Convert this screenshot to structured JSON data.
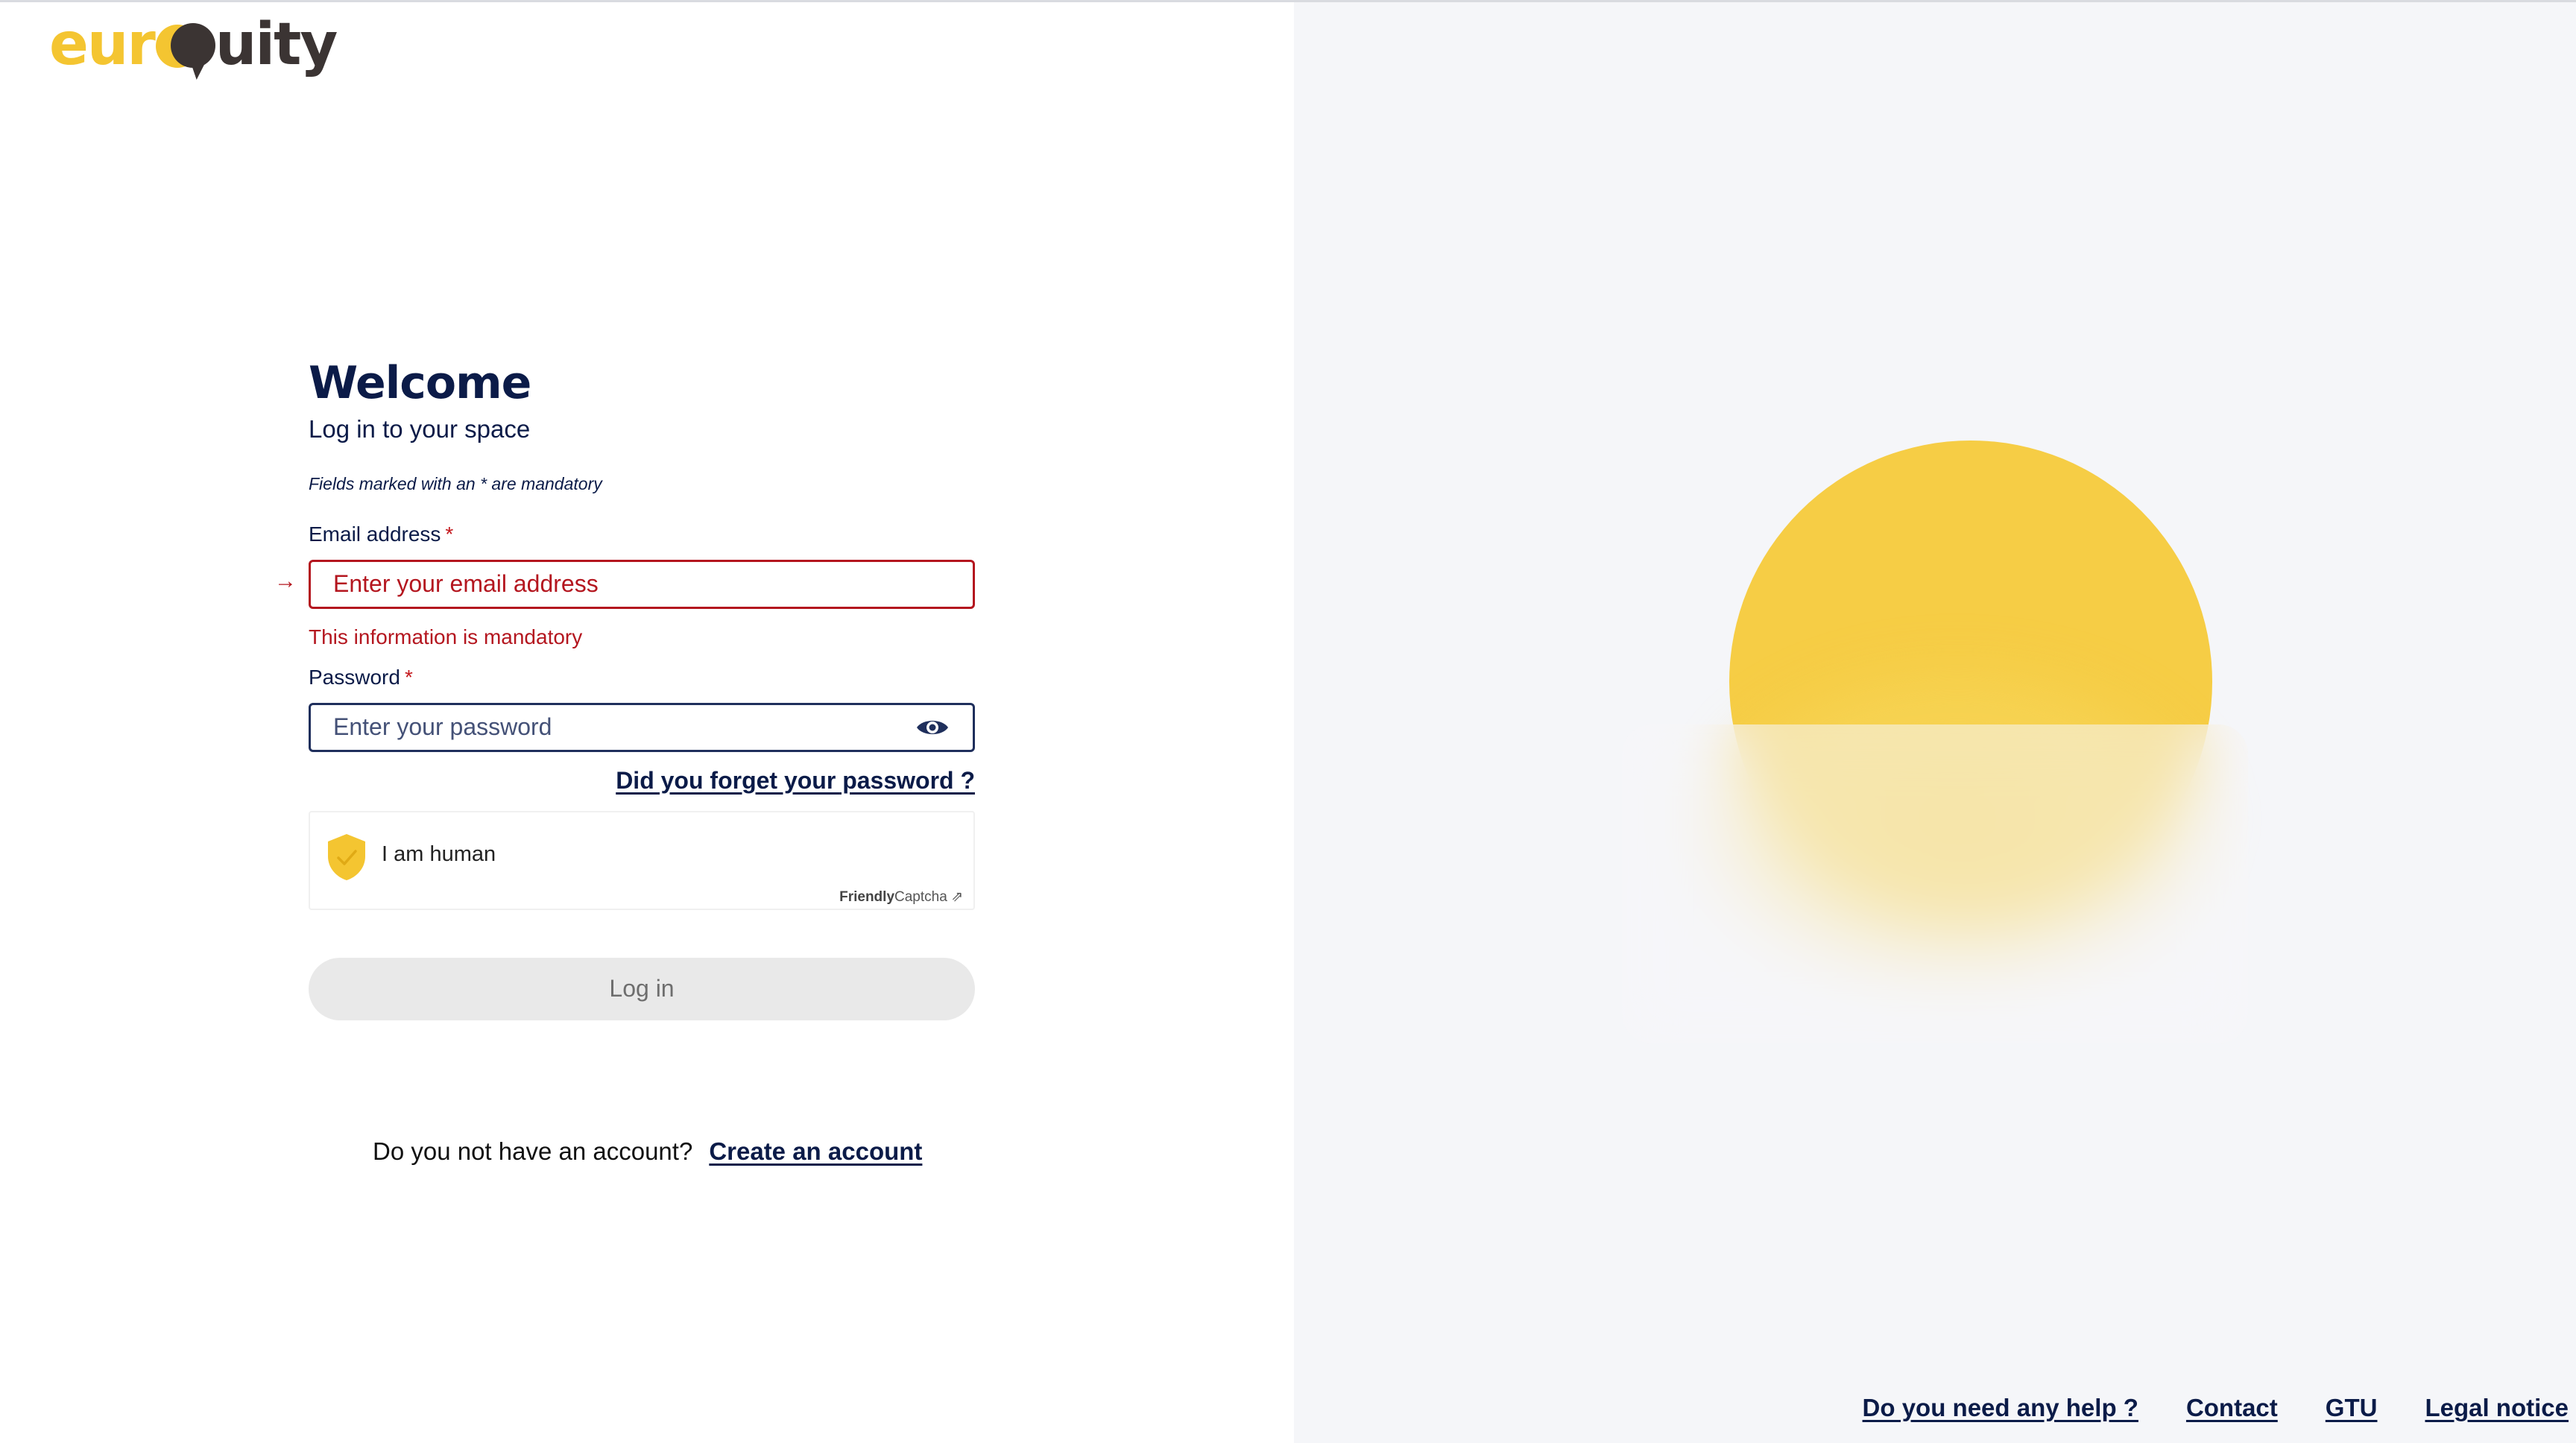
{
  "brand": {
    "logo_part1": "eur",
    "logo_part2": "uity"
  },
  "login": {
    "title": "Welcome",
    "subtitle": "Log in to your space",
    "mandatory_note": "Fields marked with an * are mandatory",
    "email": {
      "label": "Email address",
      "required_mark": "*",
      "placeholder": "Enter your email address",
      "error": "This information is mandatory"
    },
    "password": {
      "label": "Password",
      "required_mark": "*",
      "placeholder": "Enter your password"
    },
    "forgot_password": "Did you forget your password ?",
    "captcha": {
      "label": "I am human",
      "brand_bold": "Friendly",
      "brand_rest": "Captcha",
      "shield_color": "#f4c531"
    },
    "submit_label": "Log in",
    "no_account_text": "Do you not have an account?",
    "create_account_link": "Create an account"
  },
  "footer": {
    "links": [
      "Do you need any help ?",
      "Contact",
      "GTU",
      "Legal notice"
    ]
  },
  "colors": {
    "navy": "#0b1b48",
    "error_red": "#b4161f",
    "brand_yellow": "#f4c531",
    "brand_dark": "#3b3433",
    "right_panel_bg": "#f5f6f9"
  }
}
